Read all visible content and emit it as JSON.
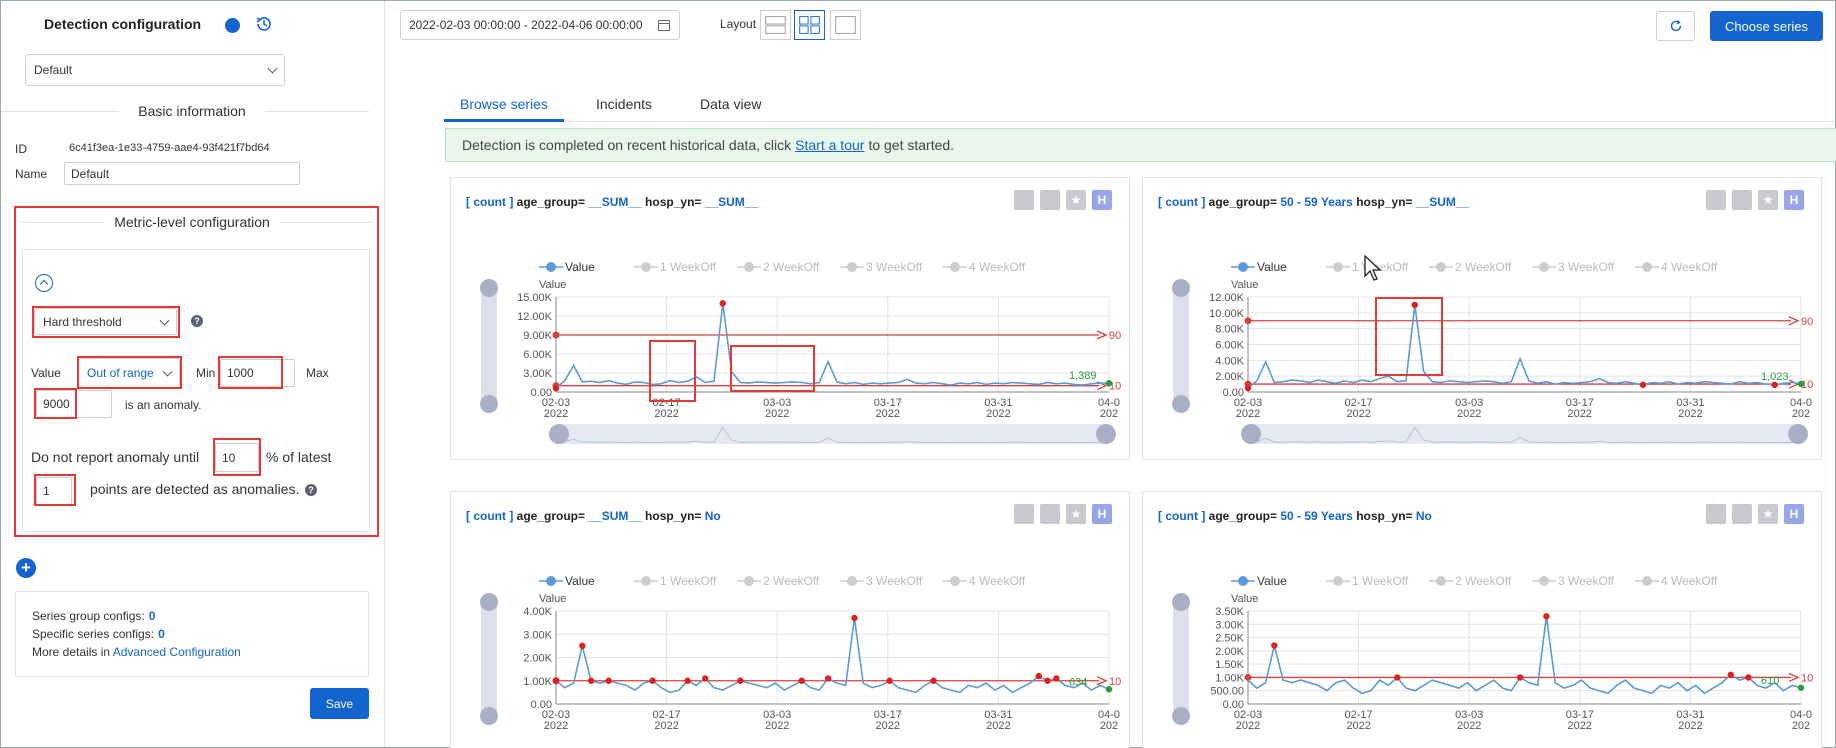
{
  "left": {
    "title": "Detection configuration",
    "preset_select": "Default",
    "basic_info_heading": "Basic information",
    "id_label": "ID",
    "id_value": "6c41f3ea-1e33-4759-aae4-93f421f7bd64",
    "name_label": "Name",
    "name_value": "Default",
    "metric_heading": "Metric-level configuration",
    "threshold_type": "Hard threshold",
    "value_label": "Value",
    "value_mode": "Out of range",
    "min_label": "Min",
    "min_value": "1000",
    "max_label": "Max",
    "max_value": "9000",
    "is_anomaly": "is an anomaly.",
    "report_prefix": "Do not report anomaly until",
    "report_pct": "10",
    "report_pct_suffix": "% of latest",
    "report_points": "1",
    "report_suffix": "points are detected as anomalies.",
    "series_group_label": "Series group configs:",
    "series_group_count": "0",
    "specific_label": "Specific series configs:",
    "specific_count": "0",
    "more_details": "More details in",
    "advanced_link": "Advanced Configuration",
    "save": "Save"
  },
  "top": {
    "date_range": "2022-02-03 00:00:00 - 2022-04-06 00:00:00",
    "layout_label": "Layout",
    "choose_series": "Choose series"
  },
  "tabs": [
    "Browse series",
    "Incidents",
    "Data view"
  ],
  "banner": {
    "prefix": "Detection is completed on recent historical data, click",
    "link": "Start a tour",
    "suffix": "to get started."
  },
  "cards": [
    {
      "count_label": "[ count ]",
      "k1": "age_group=",
      "v1": "__SUM__",
      "k2": "hosp_yn=",
      "v2": "__SUM__",
      "legend": [
        "Value",
        "1 WeekOff",
        "2 WeekOff",
        "3 WeekOff",
        "4 WeekOff"
      ],
      "ylabel": "Value",
      "yticks": [
        "15.00K",
        "12.00K",
        "9.00K",
        "6.00K",
        "3.00K",
        "0.00"
      ],
      "ymax": 15000,
      "xticks": [
        [
          "02-03",
          "2022"
        ],
        [
          "02-17",
          "2022"
        ],
        [
          "03-03",
          "2022"
        ],
        [
          "03-17",
          "2022"
        ],
        [
          "03-31",
          "2022"
        ],
        [
          "04-0",
          "202"
        ]
      ],
      "last_label": "1,389",
      "upper_label": "90",
      "lower_label": "10",
      "upper": 9000,
      "lower": 1000,
      "values": [
        600,
        1800,
        4200,
        1600,
        1700,
        1500,
        1800,
        1400,
        1200,
        1600,
        1500,
        1200,
        1300,
        1800,
        1500,
        1700,
        2400,
        1500,
        1700,
        14000,
        3200,
        1500,
        1400,
        1600,
        1500,
        1400,
        1500,
        1600,
        1500,
        1300,
        1500,
        4800,
        1600,
        1300,
        1500,
        1200,
        1400,
        1300,
        1400,
        1500,
        2000,
        1400,
        1300,
        1500,
        1300,
        1100,
        1400,
        1300,
        1500,
        1200,
        1400,
        1300,
        1500,
        1400,
        1300,
        1200,
        1500,
        1300,
        1400,
        1200,
        1100,
        1300,
        1400,
        1389
      ]
    },
    {
      "count_label": "[ count ]",
      "k1": "age_group=",
      "v1": "50 - 59 Years",
      "k2": "hosp_yn=",
      "v2": "__SUM__",
      "legend": [
        "Value",
        "1 WeekOff",
        "2 WeekOff",
        "3 WeekOff",
        "4 WeekOff"
      ],
      "ylabel": "Value",
      "yticks": [
        "12.00K",
        "10.00K",
        "8.00K",
        "6.00K",
        "4.00K",
        "2.00K",
        "0.00"
      ],
      "ymax": 12000,
      "xticks": [
        [
          "02-03",
          "2022"
        ],
        [
          "02-17",
          "2022"
        ],
        [
          "03-03",
          "2022"
        ],
        [
          "03-17",
          "2022"
        ],
        [
          "03-31",
          "2022"
        ],
        [
          "04-0",
          "202"
        ]
      ],
      "last_label": "1,023",
      "upper_label": "90",
      "lower_label": "10",
      "upper": 9000,
      "lower": 1000,
      "values": [
        500,
        1400,
        3800,
        1200,
        1300,
        1500,
        1400,
        1200,
        1500,
        1300,
        1100,
        1400,
        1200,
        1500,
        1300,
        1700,
        2000,
        1300,
        1400,
        11000,
        2600,
        1300,
        1200,
        1400,
        1300,
        1200,
        1300,
        1400,
        1300,
        1100,
        1300,
        4200,
        1400,
        1100,
        1300,
        1000,
        1200,
        1100,
        1200,
        1300,
        1700,
        1200,
        1100,
        1300,
        1100,
        900,
        1200,
        1100,
        1300,
        1000,
        1200,
        1100,
        1300,
        1200,
        1100,
        1000,
        1300,
        1100,
        1200,
        1000,
        900,
        1100,
        1200,
        1023
      ]
    },
    {
      "count_label": "[ count ]",
      "k1": "age_group=",
      "v1": "__SUM__",
      "k2": "hosp_yn=",
      "v2": "No",
      "legend": [
        "Value",
        "1 WeekOff",
        "2 WeekOff",
        "3 WeekOff",
        "4 WeekOff"
      ],
      "ylabel": "Value",
      "yticks": [
        "4.00K",
        "3.00K",
        "2.00K",
        "1.00K",
        "0.00"
      ],
      "ymax": 4000,
      "xticks": [
        [
          "02-03",
          "2022"
        ],
        [
          "02-17",
          "2022"
        ],
        [
          "03-03",
          "2022"
        ],
        [
          "03-17",
          "2022"
        ],
        [
          "03-31",
          "2022"
        ],
        [
          "04-0",
          "202"
        ]
      ],
      "last_label": "634",
      "upper_label": "10",
      "lower_label": "",
      "upper": 1000,
      "lower": null,
      "values": [
        1000,
        700,
        900,
        2500,
        1000,
        900,
        1000,
        900,
        800,
        600,
        900,
        1000,
        700,
        500,
        600,
        1000,
        800,
        1100,
        700,
        600,
        800,
        1000,
        900,
        800,
        700,
        900,
        600,
        800,
        1000,
        700,
        600,
        1100,
        900,
        800,
        3700,
        900,
        700,
        800,
        1000,
        700,
        600,
        500,
        800,
        1000,
        700,
        600,
        500,
        800,
        700,
        900,
        600,
        800,
        500,
        700,
        900,
        1200,
        1000,
        1100,
        800,
        700,
        900,
        600,
        800,
        634
      ]
    },
    {
      "count_label": "[ count ]",
      "k1": "age_group=",
      "v1": "50 - 59 Years",
      "k2": "hosp_yn=",
      "v2": "No",
      "legend": [
        "Value",
        "1 WeekOff",
        "2 WeekOff",
        "3 WeekOff",
        "4 WeekOff"
      ],
      "ylabel": "Value",
      "yticks": [
        "3.50K",
        "3.00K",
        "2.50K",
        "2.00K",
        "1.50K",
        "1.00K",
        "500.00",
        "0.00"
      ],
      "ymax": 3500,
      "xticks": [
        [
          "02-03",
          "2022"
        ],
        [
          "02-17",
          "2022"
        ],
        [
          "03-03",
          "2022"
        ],
        [
          "03-17",
          "2022"
        ],
        [
          "03-31",
          "2022"
        ],
        [
          "04-0",
          "202"
        ]
      ],
      "last_label": "610",
      "upper_label": "10",
      "lower_label": "",
      "upper": 1000,
      "lower": null,
      "values": [
        900,
        600,
        800,
        2200,
        900,
        800,
        900,
        800,
        700,
        500,
        800,
        900,
        600,
        400,
        500,
        900,
        700,
        1000,
        600,
        500,
        700,
        900,
        800,
        700,
        600,
        800,
        500,
        700,
        900,
        600,
        500,
        1000,
        800,
        700,
        3300,
        800,
        600,
        700,
        900,
        600,
        500,
        400,
        700,
        900,
        600,
        500,
        400,
        700,
        600,
        800,
        500,
        700,
        400,
        600,
        800,
        1100,
        900,
        1000,
        700,
        600,
        800,
        500,
        700,
        610
      ]
    }
  ],
  "colors": {
    "accent": "#1464d0",
    "line": "#5b9bd5",
    "anomaly": "#e02020",
    "threshold": "#d84040",
    "highlight": "#e53935"
  }
}
